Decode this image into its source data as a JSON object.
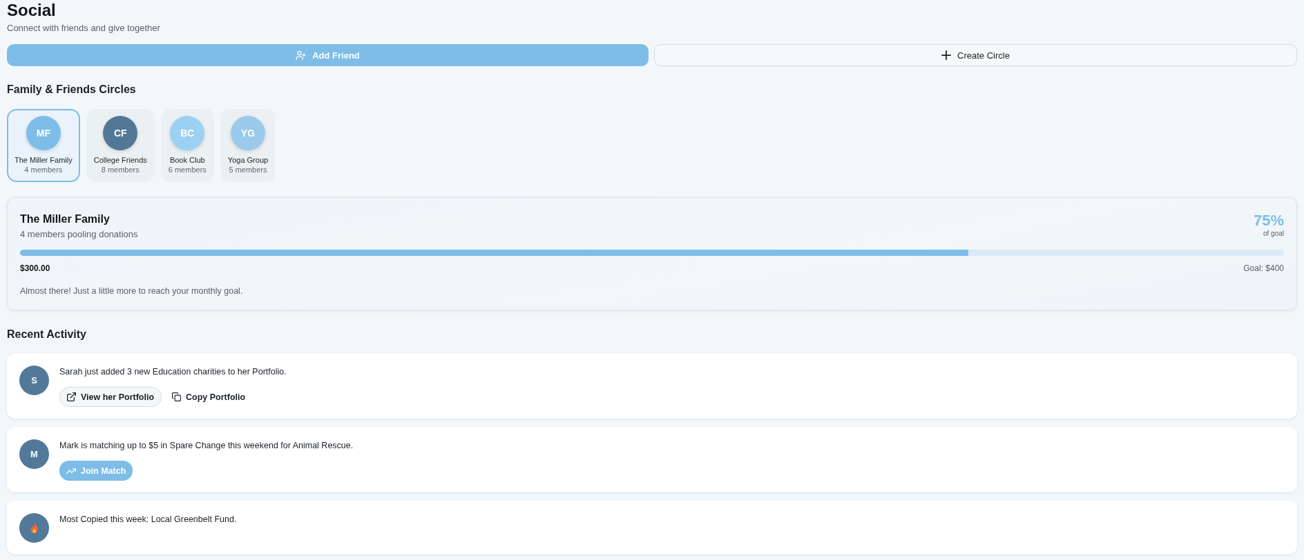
{
  "header": {
    "title": "Social",
    "subtitle": "Connect with friends and give together"
  },
  "actions": [
    {
      "label": "Add Friend",
      "kind": "primary"
    },
    {
      "label": "Create Circle",
      "kind": "secondary"
    }
  ],
  "circles": {
    "heading": "Family & Friends Circles",
    "items": [
      {
        "initials": "MF",
        "name": "The Miller Family",
        "members": "4 members",
        "color": "#7dbde8",
        "selected": true
      },
      {
        "initials": "CF",
        "name": "College Friends",
        "members": "8 members",
        "color": "#527896",
        "selected": false
      },
      {
        "initials": "BC",
        "name": "Book Club",
        "members": "6 members",
        "color": "#9dd1f3",
        "selected": false
      },
      {
        "initials": "YG",
        "name": "Yoga Group",
        "members": "5 members",
        "color": "#9ccaeb",
        "selected": false
      }
    ]
  },
  "progress": {
    "title": "The Miller Family",
    "subtitle": "4 members pooling donations",
    "percent": "75%",
    "percent_caption": "of goal",
    "level": 0.75,
    "amount": "$300.00",
    "goal": "Goal: $400",
    "message": "Almost there! Just a little more to reach your monthly goal."
  },
  "activity": {
    "heading": "Recent Activity",
    "items": [
      {
        "kind": "initial",
        "initial": "S",
        "text": "Sarah just added 3 new Education charities to her Portfolio.",
        "actions": [
          {
            "label": "View her Portfolio",
            "kind": "link"
          },
          {
            "label": "Copy Portfolio",
            "kind": "copy"
          }
        ]
      },
      {
        "kind": "initial",
        "initial": "M",
        "text": "Mark is matching up to $5 in Spare Change this weekend for Animal Rescue.",
        "actions": [
          {
            "label": "Join Match",
            "kind": "join"
          }
        ]
      },
      {
        "kind": "flame",
        "text": "Most Copied this week: Local Greenbelt Fund."
      }
    ]
  }
}
